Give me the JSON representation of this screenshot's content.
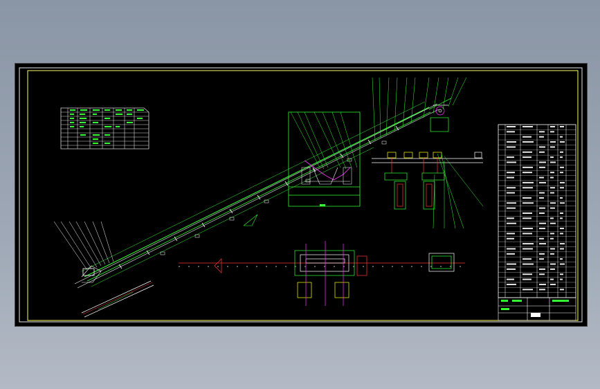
{
  "viewer": {
    "background_color": "#8f9aaa",
    "sheet_color": "#000000",
    "frame_color": "#ffff66"
  },
  "drawing": {
    "palette": {
      "structure": "#33ff33",
      "detail": "#ffffff",
      "centerline": "#ff3333",
      "highlight": "#ff33ff",
      "accent": "#ffff00"
    },
    "views": [
      "inclined-conveyor-elevation",
      "head-end-detail",
      "drive-section",
      "tail-end-detail",
      "plan-view",
      "component-table",
      "parts-list",
      "title-block"
    ],
    "text_legible": false
  }
}
